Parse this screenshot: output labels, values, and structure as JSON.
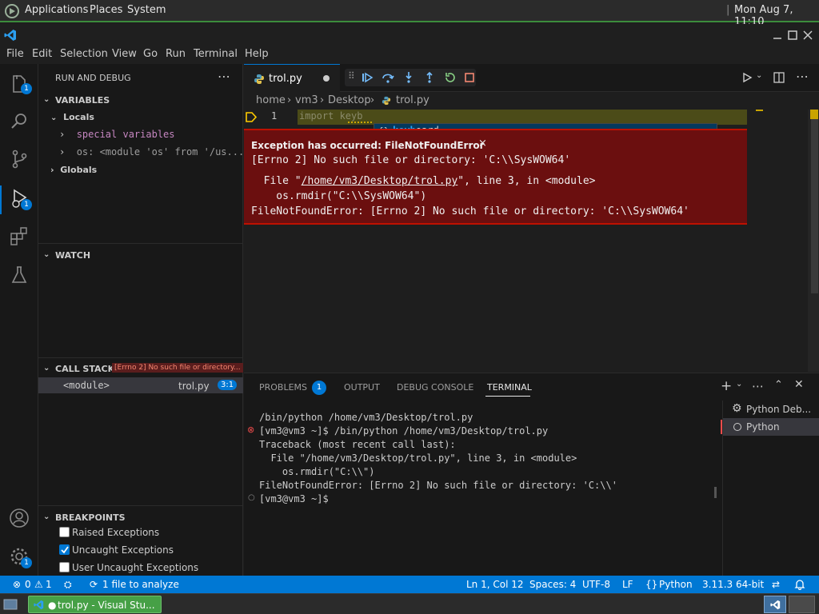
{
  "gnome_panel": {
    "menus": [
      "Applications",
      "Places",
      "System"
    ],
    "clock": "Mon Aug  7, 11:10"
  },
  "menubar": {
    "items": [
      "File",
      "Edit",
      "Selection",
      "View",
      "Go",
      "Run",
      "Terminal",
      "Help"
    ]
  },
  "activity": {
    "explorer_badge": "1",
    "debug_badge": "1",
    "settings_badge": "1"
  },
  "sidebar": {
    "title": "RUN AND DEBUG",
    "variables_header": "VARIABLES",
    "locals_label": "Locals",
    "special_vars": "special variables",
    "os_var": "os: <module 'os' from '/us...",
    "globals_label": "Globals",
    "watch_header": "WATCH",
    "callstack_header": "CALL STACK",
    "callstack_error": "[Errno 2] No such file or directory...",
    "frame_name": "<module>",
    "frame_file": "trol.py",
    "frame_pos": "3:1",
    "breakpoints_header": "BREAKPOINTS",
    "breakpoints": [
      {
        "label": "Raised Exceptions",
        "checked": false
      },
      {
        "label": "Uncaught Exceptions",
        "checked": true
      },
      {
        "label": "User Uncaught Exceptions",
        "checked": false
      }
    ]
  },
  "editor": {
    "tab_name": "trol.py",
    "breadcrumb": [
      "home",
      "vm3",
      "Desktop",
      "trol.py"
    ],
    "line_number": "1",
    "code_line": "import keyb",
    "suggest_match": "keyb",
    "suggest_rest": "oard",
    "exception_title": "Exception has occurred: FileNotFoundError",
    "exception_close": "×",
    "exception_msg": "[Errno 2] No such file or directory: 'C:\\\\SysWOW64'",
    "trace_file_prefix": "  File \"",
    "trace_file_path": "/home/vm3/Desktop/trol.py",
    "trace_file_suffix": "\", line 3, in <module>",
    "trace_code": "    os.rmdir(\"C:\\\\SysWOW64\")",
    "trace_error": "FileNotFoundError: [Errno 2] No such file or directory: 'C:\\\\SysWOW64'"
  },
  "panel": {
    "tabs": [
      "PROBLEMS",
      "OUTPUT",
      "DEBUG CONSOLE",
      "TERMINAL"
    ],
    "problems_count": "1",
    "terminal_lines": [
      "/bin/python /home/vm3/Desktop/trol.py",
      "[vm3@vm3 ~]$ /bin/python /home/vm3/Desktop/trol.py",
      "Traceback (most recent call last):",
      "  File \"/home/vm3/Desktop/trol.py\", line 3, in <module>",
      "    os.rmdir(\"C:\\\\\")",
      "FileNotFoundError: [Errno 2] No such file or directory: 'C:\\\\'",
      "[vm3@vm3 ~]$"
    ],
    "terminals": [
      "Python Deb...",
      "Python"
    ]
  },
  "statusbar": {
    "errors": "0",
    "warnings": "1",
    "analyze": "1 file to analyze",
    "position": "Ln 1, Col 12",
    "spaces": "Spaces: 4",
    "encoding": "UTF-8",
    "eol": "LF",
    "language": "Python",
    "interpreter": "3.11.3 64-bit"
  },
  "taskbar": {
    "window_title": "trol.py - Visual Stu..."
  },
  "colors": {
    "accent": "#0078d4",
    "exception_bg": "#6b0f0f",
    "panel_green": "#3c8c3c"
  }
}
